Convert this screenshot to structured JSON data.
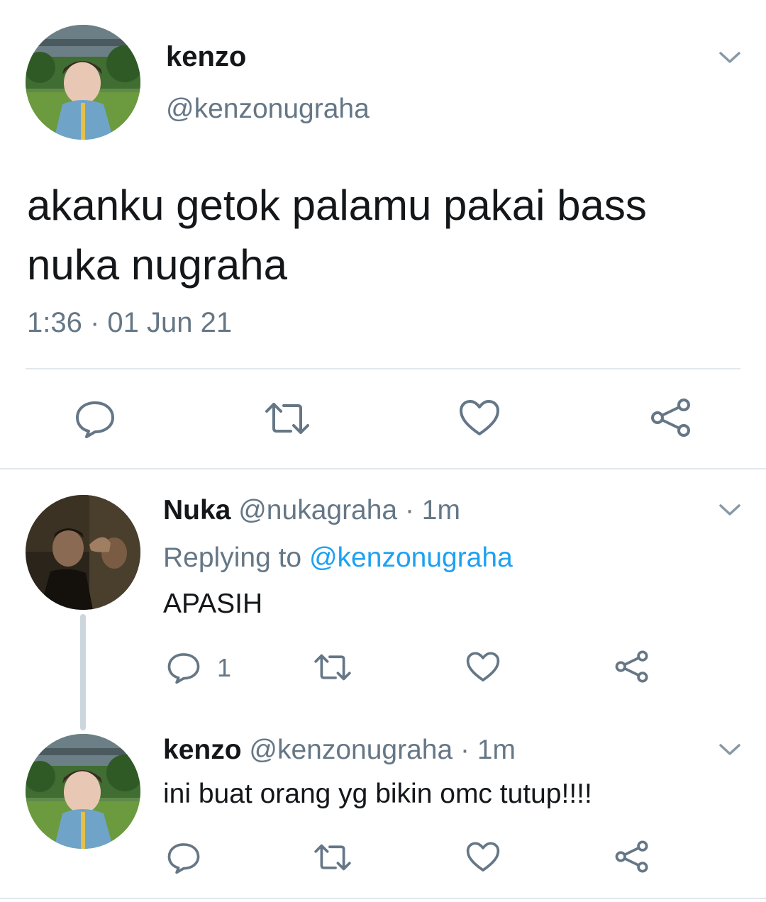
{
  "main_tweet": {
    "author_name": "kenzo",
    "author_handle": "@kenzonugraha",
    "text_line1": "akanku getok palamu pakai bass",
    "text_line2": "nuka nugraha",
    "timestamp": "1:36 · 01 Jun 21",
    "actions": [
      "reply-icon",
      "retweet-icon",
      "like-icon",
      "share-icon"
    ]
  },
  "replies": [
    {
      "author_name": "Nuka",
      "author_handle": "@nukagraha",
      "time": "· 1m",
      "replying_prefix": "Replying to",
      "replying_handle": "@kenzonugraha",
      "text": "APASIH",
      "reply_count": "1"
    },
    {
      "author_name": "kenzo",
      "author_handle": "@kenzonugraha",
      "time": "· 1m",
      "text": "ini buat orang yg bikin omc tutup!!!!"
    }
  ],
  "colors": {
    "text": "#14171a",
    "muted": "#657786",
    "link": "#1da1f2",
    "divider": "#e1e8ed"
  }
}
